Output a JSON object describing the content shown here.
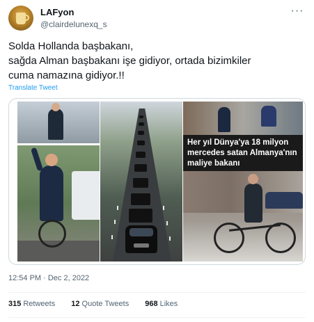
{
  "author": {
    "display_name": "LAFyon",
    "handle": "@clairdelunexq_s",
    "avatar_icon": "avatar-image"
  },
  "more_icon": "more-dots-icon",
  "more_glyph": "···",
  "tweet": {
    "text_lines": [
      "Solda Hollanda başbakanı,",
      "sağda Alman başbakanı işe gidiyor, ortada bizimkiler",
      "cuma namazına gidiyor.!!"
    ],
    "translate_label": "Translate Tweet"
  },
  "media": {
    "caption_lines": [
      "Her yıl Dünya'ya 18 milyon",
      "mercedes satan Almanya'nın",
      "maliye bakanı"
    ]
  },
  "timestamp": "12:54 PM · Dec 2, 2022",
  "stats": {
    "retweets_count": "315",
    "retweets_label": "Retweets",
    "quotes_count": "12",
    "quotes_label": "Quote Tweets",
    "likes_count": "968",
    "likes_label": "Likes"
  },
  "colors": {
    "link": "#1d9bf0",
    "secondary_text": "#536471",
    "primary_text": "#0f1419",
    "border": "#cfd9de"
  }
}
